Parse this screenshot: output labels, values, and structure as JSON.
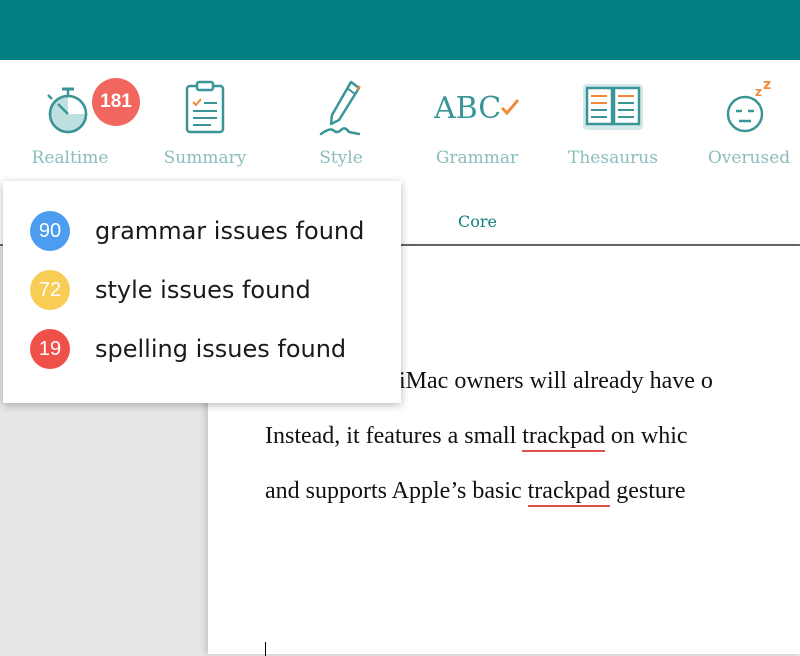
{
  "colors": {
    "header": "#017f80",
    "accent": "#0e7d7e",
    "label": "#8bbcbc",
    "badge_red": "#f26660",
    "grammar_blue": "#4c9df0",
    "style_yellow": "#f8cd55",
    "spelling_red": "#f0504a"
  },
  "toolbar": {
    "tools": [
      {
        "label": "Realtime",
        "icon": "stopwatch-icon"
      },
      {
        "label": "Summary",
        "icon": "clipboard-icon"
      },
      {
        "label": "Style",
        "icon": "pencil-icon"
      },
      {
        "label": "Grammar",
        "icon": "abc-check-icon"
      },
      {
        "label": "Thesaurus",
        "icon": "book-icon"
      },
      {
        "label": "Overused",
        "icon": "sleepy-face-icon"
      }
    ],
    "realtime_badge": "181",
    "core_tab": "Core"
  },
  "popup": {
    "rows": [
      {
        "count": "90",
        "text": "grammar issues found"
      },
      {
        "count": "72",
        "text": "style issues found"
      },
      {
        "count": "19",
        "text": "spelling issues found"
      }
    ]
  },
  "document": {
    "line1": "iMac owners will already have o",
    "line2_a": "Instead, it features a small ",
    "line2_err": "trackpad",
    "line2_b": " on whic",
    "line3_a": "and supports Apple’s basic ",
    "line3_err": "trackpad",
    "line3_b": " gesture"
  }
}
